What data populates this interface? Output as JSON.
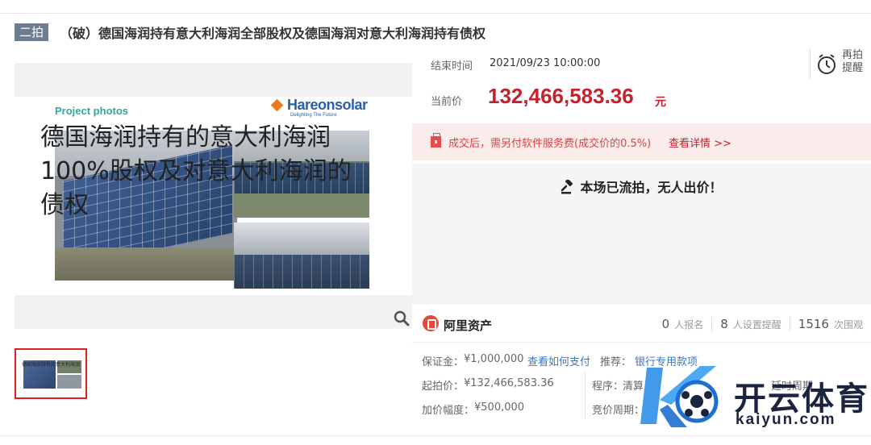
{
  "header": {
    "round_badge": "二拍",
    "title": "（破）德国海润持有意大利海润全部股权及德国海润对意大利海润持有债权"
  },
  "gallery": {
    "photo_heading": "Project photos",
    "brand_name": "Hareonsolar",
    "brand_tagline": "Delighting The Future",
    "overlay_text_line1": "德国海润持有的意大利海润",
    "overlay_text_line2": "100%股权及对意大利海润的",
    "overlay_text_line3": "债权",
    "zoom_icon": "magnifier-icon"
  },
  "auction": {
    "end_time_label": "结束时间",
    "end_time_value": "2021/09/23 10:00:00",
    "current_price_label": "当前价",
    "current_price_value": "132,466,583.36",
    "current_price_unit": "元",
    "reauction_label": "再拍提醒",
    "price_color": "#c4222d"
  },
  "notice": {
    "text": "成交后，需另付软件服务费(成交价的0.5%)",
    "link": "查看详情 >>"
  },
  "status": {
    "text": "本场已流拍，无人出价！"
  },
  "platform": {
    "name": "阿里资产",
    "stats": [
      {
        "num": "0",
        "label": "人报名"
      },
      {
        "num": "8",
        "label": "人设置提醒"
      },
      {
        "num": "1516",
        "label": "次围观"
      }
    ]
  },
  "details": {
    "deposit_label": "保证金：",
    "deposit_value": "¥1,000,000",
    "deposit_link": "查看如何支付",
    "recommend_label": "推荐：",
    "recommend_link": "银行专用款项",
    "start_price_label": "起拍价：",
    "start_price_value": "¥132,466,583.36",
    "procedure_label": "程序：",
    "procedure_value": "清算",
    "extend_text": "延时周期",
    "increment_label": "加价幅度：",
    "increment_value": "¥500,000",
    "cycle_label": "竞价周期："
  },
  "watermark": {
    "cn": "开云体育",
    "en": "kaiyun.com"
  }
}
